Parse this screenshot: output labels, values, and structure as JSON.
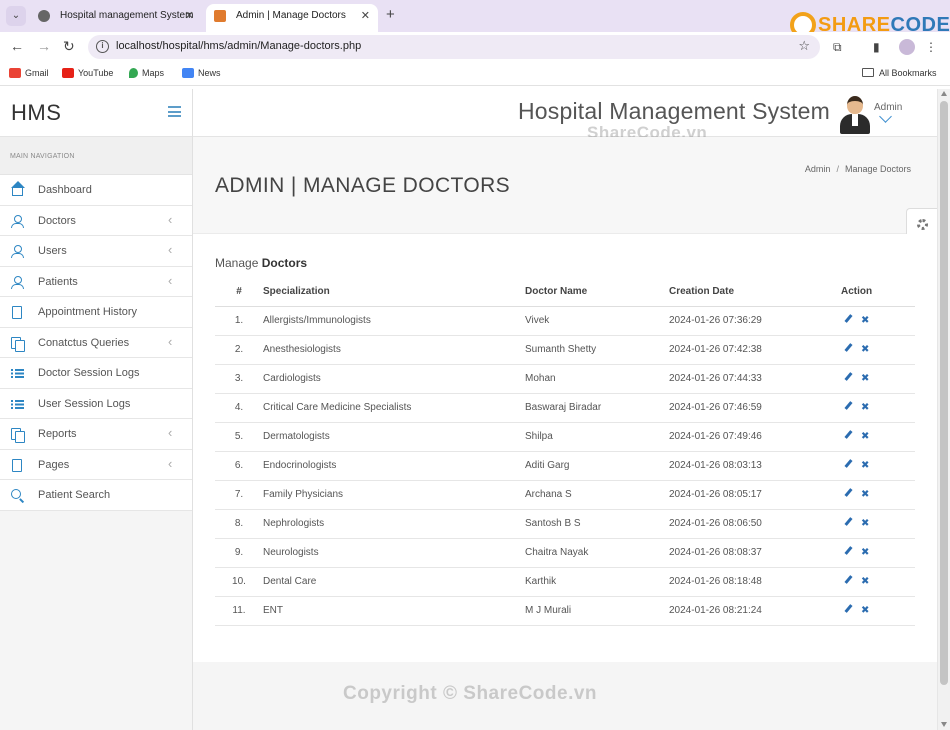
{
  "browser": {
    "tabs": [
      {
        "title": "Hospital management System"
      },
      {
        "title": "Admin | Manage Doctors"
      }
    ],
    "url": "localhost/hospital/hms/admin/Manage-doctors.php",
    "bookmarks": [
      "Gmail",
      "YouTube",
      "Maps",
      "News"
    ],
    "all_bookmarks": "All Bookmarks"
  },
  "watermark": {
    "logo_part1": "SHARE",
    "logo_part2": "CODE.vn",
    "top": "ShareCode.vn",
    "footer": "Copyright © ShareCode.vn"
  },
  "sidebar": {
    "brand": "HMS",
    "nav_label": "MAIN NAVIGATION",
    "items": [
      {
        "label": "Dashboard",
        "icon": "home-icon",
        "chevron": false
      },
      {
        "label": "Doctors",
        "icon": "user-icon",
        "chevron": true
      },
      {
        "label": "Users",
        "icon": "user-icon",
        "chevron": true
      },
      {
        "label": "Patients",
        "icon": "user-icon",
        "chevron": true
      },
      {
        "label": "Appointment History",
        "icon": "file-icon",
        "chevron": false
      },
      {
        "label": "Conatctus Queries",
        "icon": "files-icon",
        "chevron": true
      },
      {
        "label": "Doctor Session Logs",
        "icon": "list-icon",
        "chevron": false
      },
      {
        "label": "User Session Logs",
        "icon": "list-icon",
        "chevron": false
      },
      {
        "label": "Reports",
        "icon": "files-icon",
        "chevron": true
      },
      {
        "label": "Pages",
        "icon": "file-icon",
        "chevron": true
      },
      {
        "label": "Patient Search",
        "icon": "search-icon",
        "chevron": false
      }
    ]
  },
  "header": {
    "system_title": "Hospital Management System",
    "admin_label": "Admin"
  },
  "page": {
    "title": "ADMIN | MANAGE DOCTORS",
    "breadcrumb": [
      "Admin",
      "Manage Doctors"
    ],
    "section_prefix": "Manage",
    "section_bold": "Doctors"
  },
  "table": {
    "headers": [
      "#",
      "Specialization",
      "Doctor Name",
      "Creation Date",
      "Action"
    ],
    "rows": [
      {
        "num": "1.",
        "spec": "Allergists/Immunologists",
        "name": "Vivek",
        "date": "2024-01-26 07:36:29"
      },
      {
        "num": "2.",
        "spec": "Anesthesiologists",
        "name": "Sumanth Shetty",
        "date": "2024-01-26 07:42:38"
      },
      {
        "num": "3.",
        "spec": "Cardiologists",
        "name": "Mohan",
        "date": "2024-01-26 07:44:33"
      },
      {
        "num": "4.",
        "spec": "Critical Care Medicine Specialists",
        "name": "Baswaraj Biradar",
        "date": "2024-01-26 07:46:59"
      },
      {
        "num": "5.",
        "spec": "Dermatologists",
        "name": "Shilpa",
        "date": "2024-01-26 07:49:46"
      },
      {
        "num": "6.",
        "spec": "Endocrinologists",
        "name": "Aditi Garg",
        "date": "2024-01-26 08:03:13"
      },
      {
        "num": "7.",
        "spec": "Family Physicians",
        "name": "Archana S",
        "date": "2024-01-26 08:05:17"
      },
      {
        "num": "8.",
        "spec": "Nephrologists",
        "name": "Santosh B S",
        "date": "2024-01-26 08:06:50"
      },
      {
        "num": "9.",
        "spec": "Neurologists",
        "name": "Chaitra Nayak",
        "date": "2024-01-26 08:08:37"
      },
      {
        "num": "10.",
        "spec": "Dental Care",
        "name": "Karthik",
        "date": "2024-01-26 08:18:48"
      },
      {
        "num": "11.",
        "spec": "ENT",
        "name": "M J Murali",
        "date": "2024-01-26 08:21:24"
      }
    ]
  },
  "colors": {
    "accent": "#2d86c3",
    "action": "#2b6cb0",
    "tabbar": "#e9e1f4"
  }
}
